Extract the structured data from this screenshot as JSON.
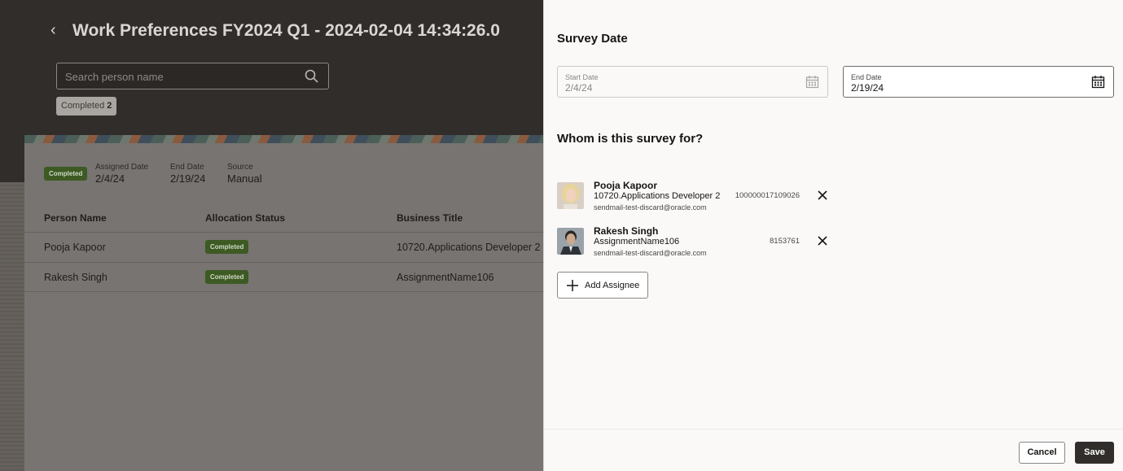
{
  "background_page": {
    "title": "Work Preferences FY2024 Q1 - 2024-02-04 14:34:26.0",
    "search": {
      "placeholder": "Search person name"
    },
    "filter_chip": {
      "label": "Completed",
      "count": "2"
    },
    "card": {
      "status_badge": "Completed",
      "assigned_date_label": "Assigned Date",
      "assigned_date": "2/4/24",
      "end_date_label": "End Date",
      "end_date": "2/19/24",
      "source_label": "Source",
      "source": "Manual"
    },
    "table": {
      "headers": [
        "Person Name",
        "Allocation Status",
        "Business Title"
      ],
      "rows": [
        {
          "name": "Pooja Kapoor",
          "status": "Completed",
          "title": "10720.Applications Developer 2"
        },
        {
          "name": "Rakesh Singh",
          "status": "Completed",
          "title": "AssignmentName106"
        }
      ]
    }
  },
  "drawer": {
    "survey_date_heading": "Survey Date",
    "start_date": {
      "label": "Start Date",
      "value": "2/4/24"
    },
    "end_date": {
      "label": "End Date",
      "value": "2/19/24"
    },
    "whom_heading": "Whom is this survey for?",
    "assignees": [
      {
        "name": "Pooja Kapoor",
        "title": "10720.Applications Developer 2",
        "email": "sendmail-test-discard@oracle.com",
        "number": "100000017109026"
      },
      {
        "name": "Rakesh Singh",
        "title": "AssignmentName106",
        "email": "sendmail-test-discard@oracle.com",
        "number": "8153761"
      }
    ],
    "add_assignee_label": "Add Assignee",
    "cancel_label": "Cancel",
    "save_label": "Save"
  },
  "colors": {
    "badge_green": "#3d5a23",
    "primary_button": "#312d2a",
    "drawer_bg": "#fbf9f8"
  }
}
